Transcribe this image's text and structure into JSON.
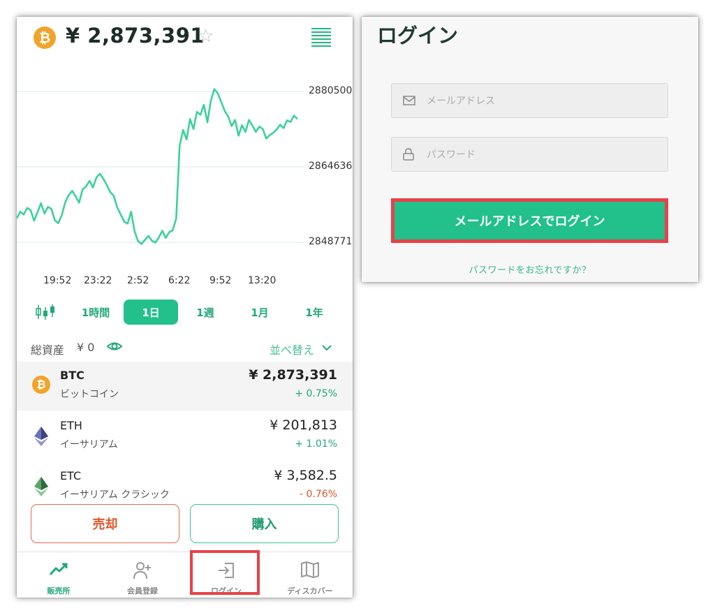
{
  "market": {
    "header": {
      "coin_symbol": "₿",
      "price": "¥ 2,873,391",
      "star_icon": "star-icon",
      "menu_icon": "list-icon"
    },
    "chart_data": {
      "type": "line",
      "series_color": "#3bd19a",
      "y_ticks": [
        "2880500",
        "2864636",
        "2848771"
      ],
      "x_ticks": [
        "19:52",
        "23:22",
        "2:52",
        "6:22",
        "9:52",
        "13:20"
      ],
      "ylim": [
        2848771,
        2880500
      ],
      "y": [
        2853800,
        2855200,
        2854600,
        2856000,
        2855500,
        2853300,
        2855100,
        2857000,
        2854800,
        2856200,
        2855800,
        2853400,
        2852800,
        2854500,
        2857200,
        2858700,
        2859600,
        2858400,
        2857100,
        2859900,
        2860500,
        2861700,
        2860300,
        2862400,
        2863200,
        2862100,
        2860800,
        2859300,
        2858500,
        2856100,
        2854600,
        2853100,
        2852700,
        2855200,
        2851100,
        2849000,
        2848400,
        2849300,
        2850100,
        2849100,
        2848700,
        2849800,
        2851200,
        2849700,
        2850900,
        2851300,
        2853700,
        2869100,
        2872400,
        2870400,
        2874700,
        2872600,
        2876200,
        2875600,
        2877700,
        2874000,
        2878500,
        2881000,
        2880100,
        2878300,
        2876400,
        2875300,
        2873200,
        2874500,
        2871200,
        2873400,
        2872000,
        2874500,
        2873300,
        2872000,
        2873100,
        2872600,
        2870600,
        2871300,
        2871800,
        2872500,
        2873500,
        2872800,
        2874400,
        2874100,
        2875400,
        2874700
      ]
    },
    "periods": [
      "1時間",
      "1日",
      "1週",
      "1月",
      "1年"
    ],
    "active_period": "1日",
    "assets": {
      "label": "総資産",
      "value": "¥ 0",
      "sort_label": "並べ替え"
    },
    "coins": [
      {
        "symbol": "BTC",
        "name_jp": "ビットコイン",
        "price": "¥ 2,873,391",
        "change": "+ 0.75%",
        "change_color": "#22a877"
      },
      {
        "symbol": "ETH",
        "name_jp": "イーサリアム",
        "price": "¥ 201,813",
        "change": "+ 1.01%",
        "change_color": "#22a877"
      },
      {
        "symbol": "ETC",
        "name_jp": "イーサリアム クラシック",
        "price": "¥ 3,582.5",
        "change": "- 0.76%",
        "change_color": "#e0552a"
      }
    ],
    "actions": {
      "sell": "売却",
      "buy": "購入"
    },
    "nav": [
      {
        "label": "販売所",
        "icon": "trend-up-icon"
      },
      {
        "label": "会員登録",
        "icon": "add-user-icon"
      },
      {
        "label": "ログイン",
        "icon": "login-icon"
      },
      {
        "label": "ディスカバー",
        "icon": "map-icon"
      }
    ],
    "colors": {
      "accent": "#22c08a",
      "sell": "#e0552a",
      "highlight": "#e8424a"
    }
  },
  "login": {
    "title": "ログイン",
    "email_placeholder": "メールアドレス",
    "password_placeholder": "パスワード",
    "submit": "メールアドレスでログイン",
    "forgot": "パスワードをお忘れですか？"
  }
}
